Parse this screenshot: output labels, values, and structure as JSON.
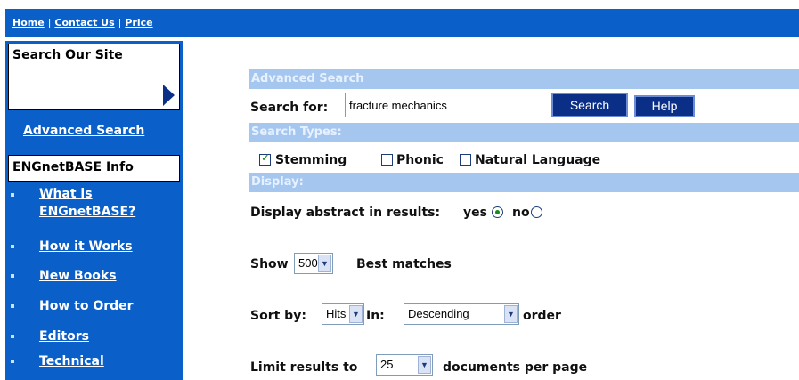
{
  "top_nav": {
    "home": "Home",
    "contact": "Contact Us",
    "price": "Price",
    "separator": "|"
  },
  "sidebar": {
    "search_title": "Search Our Site",
    "search_value": "",
    "advanced_link": "Advanced Search",
    "info_title": "ENGnetBASE Info",
    "items": [
      {
        "line1": "What is",
        "line2": "ENGnetBASE?"
      },
      {
        "line1": "How it Works"
      },
      {
        "line1": "New Books"
      },
      {
        "line1": "How to Order"
      },
      {
        "line1": "Editors"
      },
      {
        "line1": "Technical"
      }
    ]
  },
  "main": {
    "section_advanced": "Advanced Search",
    "search_for_label": "Search for:",
    "search_value": "fracture mechanics",
    "search_button": "Search",
    "help_button": "Help",
    "section_types": "Search Types:",
    "types": [
      {
        "label": "Stemming",
        "checked": true
      },
      {
        "label": "Phonic",
        "checked": false
      },
      {
        "label": "Natural Language",
        "checked": false
      }
    ],
    "section_display": "Display:",
    "display_abstract_label": "Display abstract in results:",
    "abstract_yes": "yes",
    "abstract_no": "no",
    "abstract_selected": "yes",
    "show_label": "Show",
    "show_value": "500",
    "best_matches_label": "Best matches",
    "sort_label": "Sort by:",
    "sort_value": "Hits",
    "in_label": "In:",
    "order_value": "Descending",
    "order_label": "order",
    "limit_label": "Limit results to",
    "limit_value": "25",
    "per_page_label": "documents per page"
  },
  "colors": {
    "nav_blue": "#0a5fc9",
    "section_bar": "#a5c7ef",
    "button_navy": "#0b2f86"
  }
}
